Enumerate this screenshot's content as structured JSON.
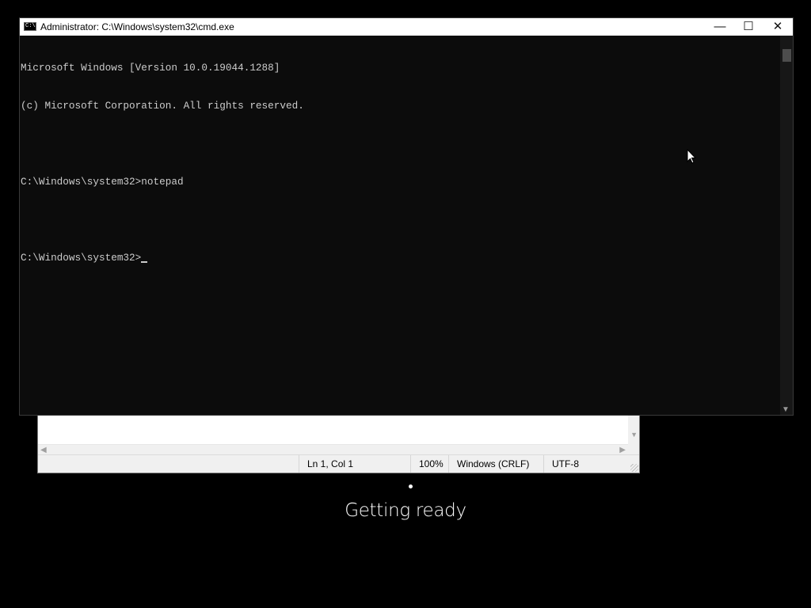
{
  "cmd": {
    "icon_text": "C:\\",
    "title": "Administrator: C:\\Windows\\system32\\cmd.exe",
    "buttons": {
      "minimize": "—",
      "maximize": "☐",
      "close": "✕"
    },
    "lines": [
      "Microsoft Windows [Version 10.0.19044.1288]",
      "(c) Microsoft Corporation. All rights reserved.",
      "",
      "C:\\Windows\\system32>notepad",
      "",
      "C:\\Windows\\system32>"
    ]
  },
  "notepad": {
    "status": {
      "position": "Ln 1, Col 1",
      "zoom": "100%",
      "line_ending": "Windows (CRLF)",
      "encoding": "UTF-8"
    }
  },
  "overlay": {
    "message": "Getting ready"
  }
}
